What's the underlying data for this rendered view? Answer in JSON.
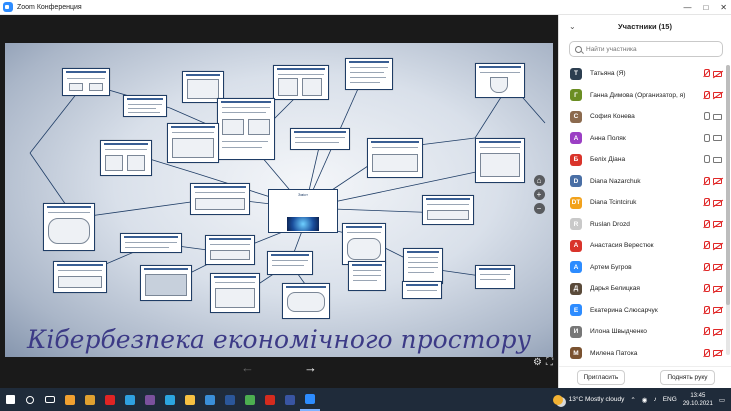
{
  "window": {
    "title": "Zoom Конференция",
    "buttons": [
      "—",
      "□",
      "✕"
    ]
  },
  "presentation": {
    "slide_title": "Кібербезпека економічного простору",
    "center_card_text": "Зміст",
    "nav_prev": "←",
    "nav_next": "→",
    "zoom_controls": [
      "⌂",
      "+",
      "−"
    ]
  },
  "participants": {
    "title": "Участники (15)",
    "search_placeholder": "Найти участника",
    "items": [
      {
        "name": "Татьяна (Я)",
        "initial": "T",
        "color": "#2c3e50",
        "mic": "off",
        "cam": "off"
      },
      {
        "name": "Ганна Димова (Организатор, я)",
        "initial": "Г",
        "color": "#6b8e23",
        "mic": "off",
        "cam": "off"
      },
      {
        "name": "София Конева",
        "initial": "С",
        "color": "#8b6a4e",
        "mic": "on",
        "cam": "on"
      },
      {
        "name": "Анна Поляк",
        "initial": "A",
        "color": "#9b3fc4",
        "mic": "on",
        "cam": "on"
      },
      {
        "name": "Беліх Діана",
        "initial": "Б",
        "color": "#d9342b",
        "mic": "on",
        "cam": "on"
      },
      {
        "name": "Diana Nazarchuk",
        "initial": "D",
        "color": "#4a6fa5",
        "mic": "off",
        "cam": "off"
      },
      {
        "name": "Diana Tcintciruk",
        "initial": "DT",
        "color": "#f2a21c",
        "mic": "off",
        "cam": "off"
      },
      {
        "name": "Ruslan Drozd",
        "initial": "R",
        "color": "#c9c9c9",
        "mic": "off",
        "cam": "off"
      },
      {
        "name": "Анастасия Верестюк",
        "initial": "A",
        "color": "#d9342b",
        "mic": "off",
        "cam": "off"
      },
      {
        "name": "Артем Бугров",
        "initial": "A",
        "color": "#2d8cff",
        "mic": "off",
        "cam": "off"
      },
      {
        "name": "Дарья Белицкая",
        "initial": "Д",
        "color": "#5a4a3a",
        "mic": "off",
        "cam": "off"
      },
      {
        "name": "Екатерина Слюсарчук",
        "initial": "E",
        "color": "#2d8cff",
        "mic": "off",
        "cam": "off"
      },
      {
        "name": "Илона Швыдченко",
        "initial": "И",
        "color": "#777777",
        "mic": "off",
        "cam": "off"
      },
      {
        "name": "Милена Патока",
        "initial": "М",
        "color": "#7a5230",
        "mic": "off",
        "cam": "off"
      }
    ],
    "invite_label": "Пригласить",
    "raise_hand_label": "Поднять руку"
  },
  "taskbar": {
    "weather": "13°C  Mostly cloudy",
    "language": "ENG",
    "time": "13:45",
    "date": "29.10.2021",
    "apps": [
      {
        "name": "windows-start-icon",
        "color": "#ffffff"
      },
      {
        "name": "search-icon",
        "color": "#ffffff"
      },
      {
        "name": "task-view-icon",
        "color": "#ffffff"
      },
      {
        "name": "media-player-icon",
        "color": "#f0a030"
      },
      {
        "name": "store-icon",
        "color": "#e0a030"
      },
      {
        "name": "opera-icon",
        "color": "#e02424"
      },
      {
        "name": "edge-icon",
        "color": "#2fa0e0"
      },
      {
        "name": "viber-icon",
        "color": "#7b519d"
      },
      {
        "name": "telegram-icon",
        "color": "#2ca5e0"
      },
      {
        "name": "explorer-icon",
        "color": "#f5c042"
      },
      {
        "name": "image-viewer-icon",
        "color": "#3a8fd9"
      },
      {
        "name": "word-icon",
        "color": "#2b579a"
      },
      {
        "name": "chrome-icon",
        "color": "#4caf50"
      },
      {
        "name": "acrobat-icon",
        "color": "#d42b1e"
      },
      {
        "name": "visio-icon",
        "color": "#3955a3"
      },
      {
        "name": "zoom-icon",
        "color": "#2d8cff"
      }
    ]
  }
}
